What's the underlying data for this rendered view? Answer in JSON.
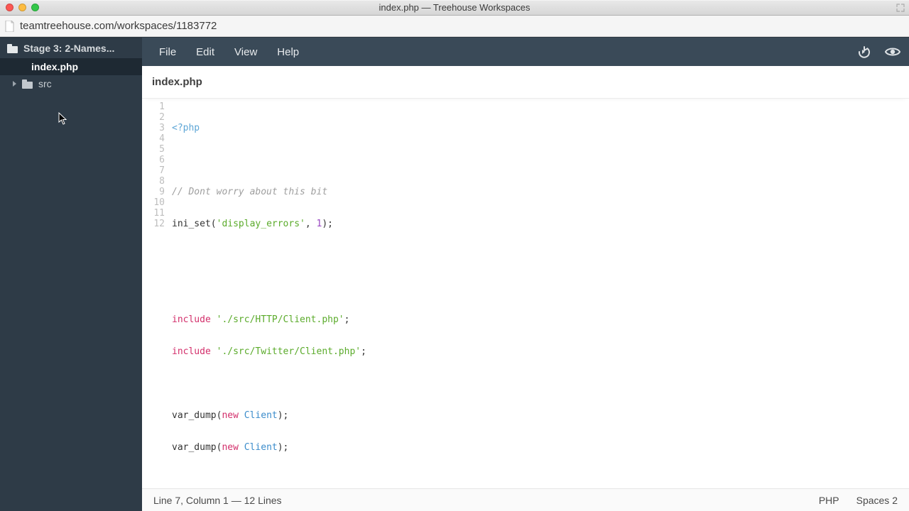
{
  "window": {
    "title": "index.php — Treehouse Workspaces"
  },
  "address": {
    "url": "teamtreehouse.com/workspaces/1183772"
  },
  "sidebar": {
    "project": "Stage 3: 2-Names...",
    "active_file": "index.php",
    "folder": "src"
  },
  "menu": {
    "file": "File",
    "edit": "Edit",
    "view": "View",
    "help": "Help"
  },
  "tab": {
    "label": "index.php"
  },
  "code": {
    "lines": [
      "1",
      "2",
      "3",
      "4",
      "5",
      "6",
      "7",
      "8",
      "9",
      "10",
      "11",
      "12"
    ],
    "l1_open": "<?php",
    "l3_cm": "// Dont worry about this bit",
    "l4_fn": "ini_set(",
    "l4_s": "'display_errors'",
    "l4_mid": ", ",
    "l4_n": "1",
    "l4_end": ");",
    "l7_kw": "include",
    "l7_s": "'./src/HTTP/Client.php'",
    "l7_end": ";",
    "l8_kw": "include",
    "l8_s": "'./src/Twitter/Client.php'",
    "l8_end": ";",
    "l10_fn": "var_dump(",
    "l10_new": "new",
    "l10_sp": " ",
    "l10_cls": "Client",
    "l10_end": ");",
    "l11_fn": "var_dump(",
    "l11_new": "new",
    "l11_sp": " ",
    "l11_cls": "Client",
    "l11_end": ");"
  },
  "status": {
    "left": "Line 7, Column 1 — 12 Lines",
    "lang": "PHP",
    "spaces": "Spaces",
    "spaces_n": "2"
  }
}
